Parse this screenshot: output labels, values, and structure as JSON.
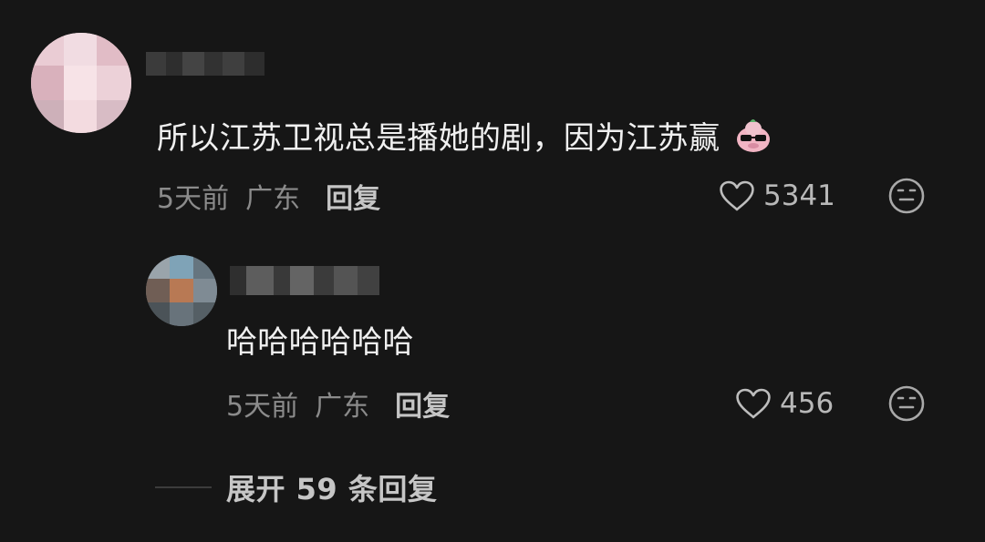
{
  "colors": {
    "background": "#161616",
    "primary_text": "#f0f0f0",
    "secondary_text": "#8b8b8b",
    "action_text": "#c5c5c5"
  },
  "comment": {
    "text": "所以江苏卫视总是播她的剧，因为江苏赢",
    "emoji_name": "sunglasses-pig-sticker",
    "time": "5天前",
    "location": "广东",
    "reply_label": "回复",
    "likes": "5341",
    "icons": {
      "like": "heart-outline-icon",
      "react": "neutral-face-icon"
    }
  },
  "reply": {
    "text": "哈哈哈哈哈哈",
    "time": "5天前",
    "location": "广东",
    "reply_label": "回复",
    "likes": "456",
    "icons": {
      "like": "heart-outline-icon",
      "react": "neutral-face-icon"
    }
  },
  "expand": {
    "text": "展开 59 条回复"
  }
}
